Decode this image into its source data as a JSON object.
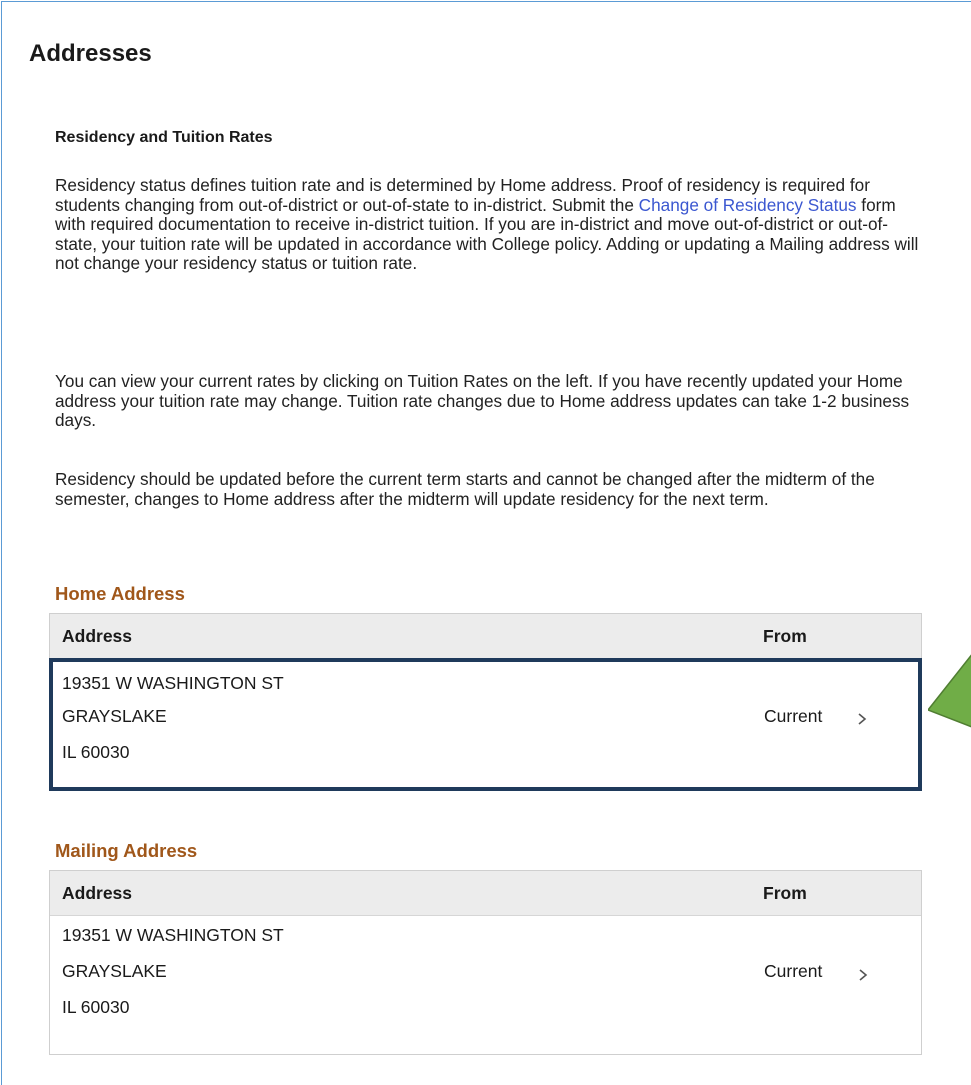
{
  "page": {
    "title": "Addresses"
  },
  "intro": {
    "heading": "Residency and Tuition Rates",
    "p1_before": "Residency status defines tuition rate and is determined by Home address. Proof of residency is required for students changing from out-of-district or out-of-state to in-district. Submit the ",
    "p1_link": "Change of Residency Status",
    "p1_after": " form with required documentation to receive in-district tuition. If you are in-district and move out-of-district or out-of-state, your tuition rate will be updated in accordance with College policy. Adding or updating a Mailing address will not change your residency status or tuition rate.",
    "p2": "You can view your current rates by clicking on Tuition Rates on the left. If you have recently updated your Home address your tuition rate may change. Tuition rate changes due to Home address updates can take 1-2 business days.",
    "p3": "Residency should be updated before the current term starts and cannot be changed after the midterm of the semester, changes to Home address after the midterm will update residency for the next term."
  },
  "home_address": {
    "title": "Home Address",
    "columns": {
      "address": "Address",
      "from": "From"
    },
    "row": {
      "line1": "19351 W WASHINGTON ST",
      "line2": "GRAYSLAKE",
      "line3": "IL 60030",
      "from": "Current"
    }
  },
  "mailing_address": {
    "title": "Mailing Address",
    "columns": {
      "address": "Address",
      "from": "From"
    },
    "row": {
      "line1": "19351 W WASHINGTON ST",
      "line2": "GRAYSLAKE",
      "line3": "IL 60030",
      "from": "Current"
    }
  },
  "colors": {
    "section_title": "#a0571a",
    "link": "#3b57d0",
    "highlight_border": "#1f3a5b",
    "callout_arrow": "#70ad47",
    "header_bg": "#ececec"
  },
  "icons": {
    "row_chevron": "chevron-right-icon",
    "callout": "green-arrow-icon"
  }
}
